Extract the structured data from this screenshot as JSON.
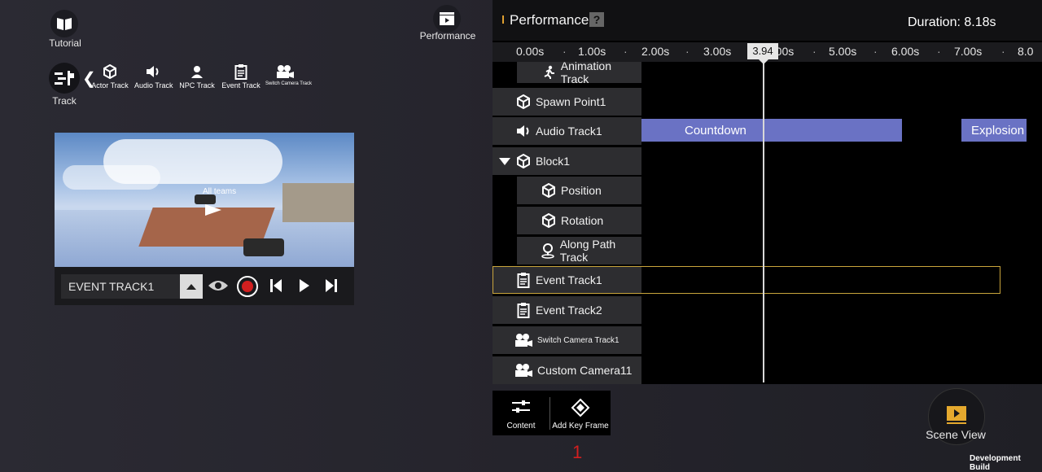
{
  "left_tools": {
    "tutorial_label": "Tutorial",
    "performance_label": "Performance",
    "track_label": "Track",
    "toolbar": [
      {
        "label": "Actor Track",
        "icon": "cube-icon"
      },
      {
        "label": "Audio Track",
        "icon": "speaker-icon"
      },
      {
        "label": "NPC Track",
        "icon": "person-icon"
      },
      {
        "label": "Event Track",
        "icon": "clipboard-icon"
      },
      {
        "label": "Switch Camera Track",
        "icon": "camera-icon"
      }
    ]
  },
  "preview": {
    "scene_text": "All teams",
    "track_name": "EVENT TRACK1"
  },
  "timeline": {
    "title": "Performance1",
    "help_icon": "?",
    "duration": "Duration: 8.18s",
    "ticks": [
      "0.00s",
      "1.00s",
      "2.00s",
      "3.00s",
      "4.00s",
      "5.00s",
      "6.00s",
      "7.00s",
      "8.0"
    ],
    "playhead": "3.94",
    "tracks": [
      {
        "label": "Animation Track",
        "icon": "running-icon",
        "indent": 2
      },
      {
        "label": "Spawn Point1",
        "icon": "cube-icon",
        "indent": 1
      },
      {
        "label": "Audio Track1",
        "icon": "speaker-icon",
        "indent": 1
      },
      {
        "label": "Block1",
        "icon": "cube-icon",
        "indent": 1
      },
      {
        "label": "Position",
        "icon": "cube-icon",
        "indent": 2
      },
      {
        "label": "Rotation",
        "icon": "cube-icon",
        "indent": 2
      },
      {
        "label": "Along Path Track",
        "icon": "pin-icon",
        "indent": 2
      },
      {
        "label": "Event Track1",
        "icon": "clipboard-icon",
        "indent": 1
      },
      {
        "label": "Event Track2",
        "icon": "clipboard-icon",
        "indent": 1
      },
      {
        "label": "Switch Camera Track1",
        "icon": "camera-icon",
        "indent": 1
      },
      {
        "label": "Custom Camera11",
        "icon": "camera-icon",
        "indent": 1
      }
    ],
    "clips": {
      "countdown": "Countdown",
      "explosion": "Explosion"
    }
  },
  "bottom": {
    "content_label": "Content",
    "keyframe_label": "Add Key Frame",
    "page_number": "1"
  },
  "scene_view_label": "Scene View",
  "dev_build": "Development Build",
  "colors": {
    "clip": "#6a72c4",
    "selected_outline": "#c9a53c",
    "record": "#d21f1f"
  }
}
